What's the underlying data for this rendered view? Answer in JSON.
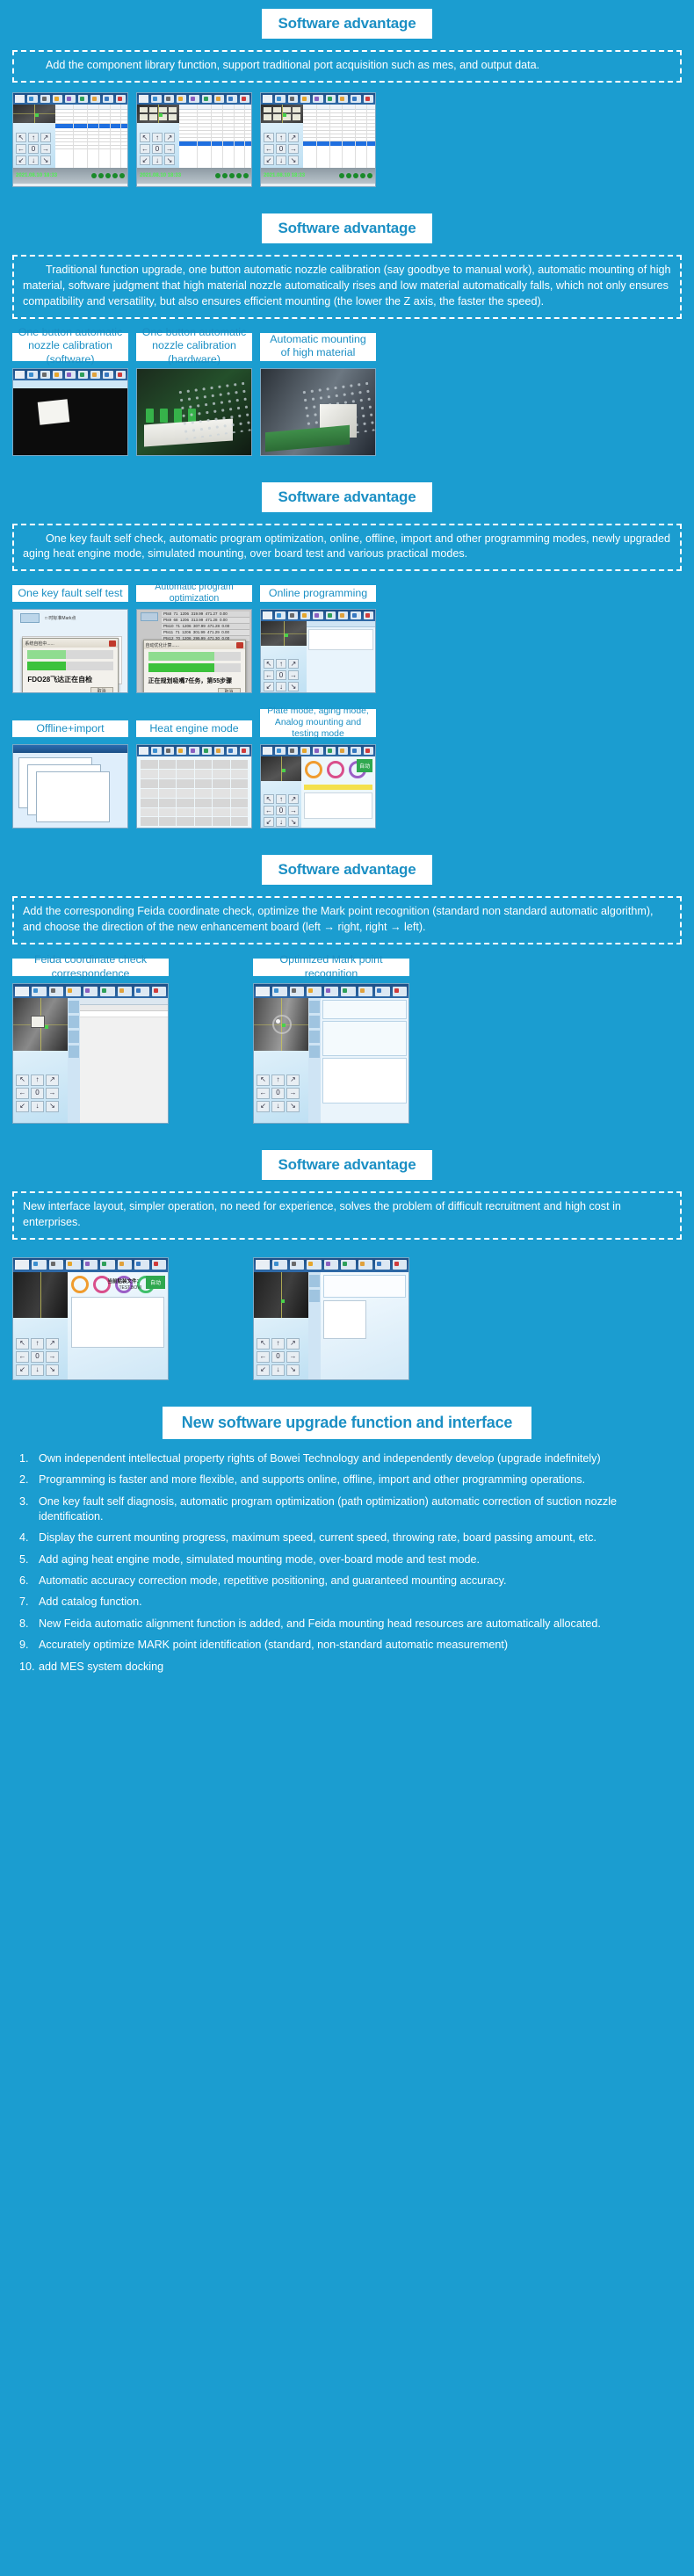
{
  "sections": [
    {
      "heading": "Software advantage",
      "description": "Add the component library function, support traditional port acquisition such as mes, and output data.",
      "labels": [],
      "shots": [
        "sw-table-1",
        "sw-table-2",
        "sw-table-3"
      ]
    },
    {
      "heading": "Software advantage",
      "description": "Traditional function upgrade, one button automatic nozzle calibration (say goodbye to manual work), automatic mounting of high material, software judgment that high material nozzle automatically rises and low material automatically falls, which not only ensures compatibility and versatility, but also ensures efficient mounting (the lower the Z axis, the faster the speed).",
      "labels": [
        "One button automatic nozzle calibration (software)",
        "One button automatic nozzle calibration (hardware)",
        "Automatic mounting of high material"
      ],
      "shots": [
        "nozzle-calib-software",
        "nozzle-calib-hardware",
        "high-material-mounting"
      ]
    },
    {
      "heading": "Software advantage",
      "description": "One key fault self check, automatic program optimization, online, offline, import and other programming modes, newly upgraded aging heat engine mode, simulated mounting, over board test and various practical modes.",
      "labels": [
        "One key fault self test",
        "Automatic program optimization",
        "Online programming"
      ],
      "labels_row2": [
        "Offline+import",
        "Heat engine mode",
        "Plate mode, aging mode,\nAnalog mounting and testing mode"
      ],
      "dialogs": [
        {
          "title": "系统自检中......",
          "message": "FDO28飞达正在自检",
          "button": "取消"
        },
        {
          "title": "自动优化计算......",
          "message": "正在规划吸嘴7任务，第55步骤",
          "button": "取消"
        }
      ]
    },
    {
      "heading": "Software advantage",
      "description": "Add the corresponding Feida coordinate check, optimize the Mark point recognition (standard non standard automatic algorithm), and choose the direction of the new enhancement board (left → right, right → left).",
      "labels": [
        "Feida coordinate check correspondence",
        "Optimized Mark point recognition"
      ],
      "shots": [
        "feida-coordinate-check",
        "optimized-mark-recognition"
      ]
    },
    {
      "heading": "Software advantage",
      "description": "New interface layout, simpler operation, no need for experience, solves the problem of difficult recruitment and high cost in enterprises.",
      "labels": [],
      "shots": [
        "new-interface-gauges",
        "new-interface-settings"
      ]
    }
  ],
  "final": {
    "heading": "New software upgrade function and interface",
    "items": [
      {
        "num": "1.",
        "text": "Own independent intellectual property rights of Bowei Technology and independently develop (upgrade indefinitely)"
      },
      {
        "num": "2.",
        "text": "Programming is faster and more flexible, and supports online, offline, import and other programming operations."
      },
      {
        "num": "3.",
        "text": "One key fault self diagnosis, automatic program optimization (path optimization) automatic correction of suction nozzle identification."
      },
      {
        "num": "4.",
        "text": "Display the current mounting progress, maximum speed, current speed, throwing rate, board passing amount, etc."
      },
      {
        "num": "5.",
        "text": "Add aging heat engine mode, simulated mounting mode, over-board mode and test mode."
      },
      {
        "num": "6.",
        "text": "Automatic accuracy correction mode, repetitive positioning, and guaranteed mounting accuracy."
      },
      {
        "num": "7.",
        "text": "Add catalog function."
      },
      {
        "num": "8.",
        "text": "New Feida automatic alignment function is added, and Feida mounting head resources are automatically allocated."
      },
      {
        "num": "9.",
        "text": "Accurately optimize MARK point identification (standard, non-standard automatic measurement)"
      },
      {
        "num": "10.",
        "text": "add MES system docking"
      }
    ]
  },
  "screenshot_details": {
    "timestamp": "2021.08.10 18:33",
    "current_file_label": "当前贴装文件：",
    "current_file_value": "TEST.BOVI",
    "auto_button": "自动"
  },
  "colors": {
    "background": "#1b9dd0",
    "heading_text": "#1b8fc4",
    "chip_bg": "#ffffff",
    "body_text": "#ffffff"
  }
}
